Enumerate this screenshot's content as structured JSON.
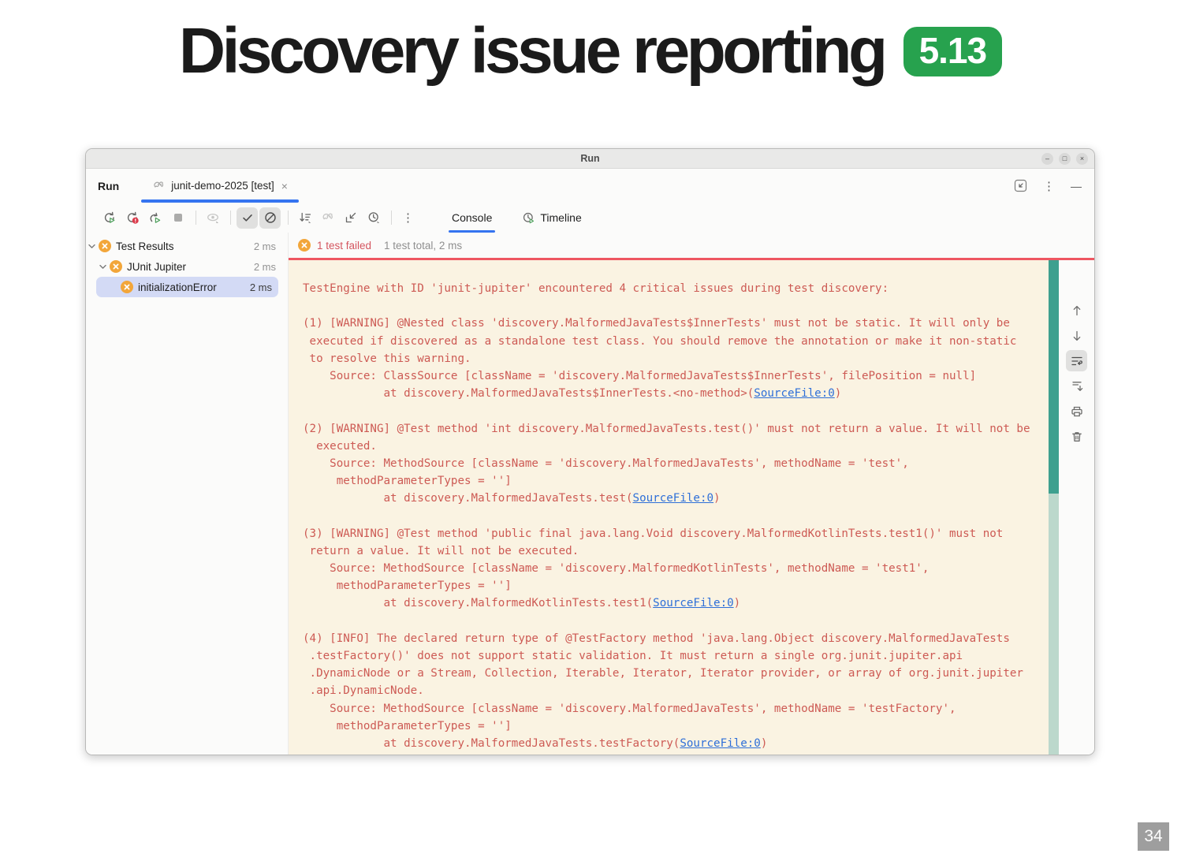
{
  "slide": {
    "title": "Discovery issue reporting",
    "version_badge": "5.13",
    "page_number": "34"
  },
  "window": {
    "titlebar_title": "Run",
    "header": {
      "tool_label": "Run",
      "tab_label": "junit-demo-2025 [test]",
      "tab_close_glyph": "×"
    },
    "view_tabs": {
      "console": "Console",
      "timeline": "Timeline"
    },
    "tree": {
      "items": [
        {
          "label": "Test Results",
          "time": "2 ms"
        },
        {
          "label": "JUnit Jupiter",
          "time": "2 ms"
        },
        {
          "label": "initializationError",
          "time": "2 ms"
        }
      ]
    },
    "status": {
      "failed": "1 test failed",
      "summary": "1 test total, 2 ms"
    },
    "console": {
      "lines": [
        [
          {
            "t": "TestEngine with ID 'junit-jupiter' encountered 4 critical issues during test discovery:"
          }
        ],
        [],
        [
          {
            "t": "(1) [WARNING] @Nested class 'discovery.MalformedJavaTests$InnerTests' must not be static. It will only be"
          }
        ],
        [
          {
            "t": " executed if discovered as a standalone test class. You should remove the annotation or make it non-static"
          }
        ],
        [
          {
            "t": " to resolve this warning."
          }
        ],
        [
          {
            "t": "    Source: ClassSource [className = 'discovery.MalformedJavaTests$InnerTests', filePosition = null]"
          }
        ],
        [
          {
            "t": "            at discovery.MalformedJavaTests$InnerTests.<no-method>("
          },
          {
            "t": "SourceFile:0",
            "link": true
          },
          {
            "t": ")"
          }
        ],
        [],
        [
          {
            "t": "(2) [WARNING] @Test method 'int discovery.MalformedJavaTests.test()' must not return a value. It will not be"
          }
        ],
        [
          {
            "t": "  executed."
          }
        ],
        [
          {
            "t": "    Source: MethodSource [className = 'discovery.MalformedJavaTests', methodName = 'test',"
          }
        ],
        [
          {
            "t": "     methodParameterTypes = '']"
          }
        ],
        [
          {
            "t": "            at discovery.MalformedJavaTests.test("
          },
          {
            "t": "SourceFile:0",
            "link": true
          },
          {
            "t": ")"
          }
        ],
        [],
        [
          {
            "t": "(3) [WARNING] @Test method 'public final java.lang.Void discovery.MalformedKotlinTests.test1()' must not"
          }
        ],
        [
          {
            "t": " return a value. It will not be executed."
          }
        ],
        [
          {
            "t": "    Source: MethodSource [className = 'discovery.MalformedKotlinTests', methodName = 'test1',"
          }
        ],
        [
          {
            "t": "     methodParameterTypes = '']"
          }
        ],
        [
          {
            "t": "            at discovery.MalformedKotlinTests.test1("
          },
          {
            "t": "SourceFile:0",
            "link": true
          },
          {
            "t": ")"
          }
        ],
        [],
        [
          {
            "t": "(4) [INFO] The declared return type of @TestFactory method 'java.lang.Object discovery.MalformedJavaTests"
          }
        ],
        [
          {
            "t": " .testFactory()' does not support static validation. It must return a single org.junit.jupiter.api"
          }
        ],
        [
          {
            "t": " .DynamicNode or a Stream, Collection, Iterable, Iterator, Iterator provider, or array of org.junit.jupiter"
          }
        ],
        [
          {
            "t": " .api.DynamicNode."
          }
        ],
        [
          {
            "t": "    Source: MethodSource [className = 'discovery.MalformedJavaTests', methodName = 'testFactory',"
          }
        ],
        [
          {
            "t": "     methodParameterTypes = '']"
          }
        ],
        [
          {
            "t": "            at discovery.MalformedJavaTests.testFactory("
          },
          {
            "t": "SourceFile:0",
            "link": true
          },
          {
            "t": ")"
          }
        ]
      ]
    }
  },
  "glyphs": {
    "win_min": "–",
    "win_max": "□",
    "win_close": "×",
    "kebab": "⋮",
    "dash": "—"
  },
  "colors": {
    "accent_blue": "#3574f0",
    "badge_green": "#27a24e",
    "console_bg": "#faf3e2",
    "console_text": "#cd5a54",
    "link_blue": "#2e6fd8",
    "red_separator": "#ee5661",
    "failed_text": "#d4555f",
    "warning_icon_amber": "#f2a63a",
    "tree_selection": "#d3daf5",
    "scrollbar_thumb": "#3ea08f",
    "scrollbar_track": "#bcd8cc"
  }
}
